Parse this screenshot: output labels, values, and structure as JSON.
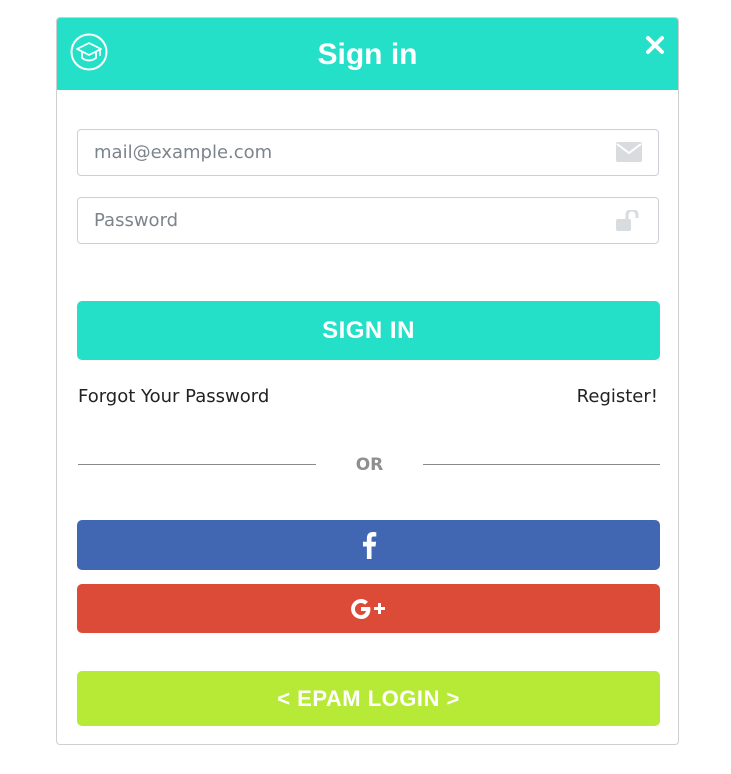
{
  "header": {
    "title": "Sign in",
    "logo_icon": "graduation-cap-icon",
    "close_icon": "close-icon",
    "accent_color": "#25e0c8"
  },
  "form": {
    "email": {
      "value": "",
      "placeholder": "mail@example.com",
      "icon": "envelope-icon"
    },
    "password": {
      "value": "",
      "placeholder": "Password",
      "icon": "unlock-icon"
    },
    "submit_label": "SIGN IN"
  },
  "links": {
    "forgot": "Forgot Your Password",
    "register": "Register!"
  },
  "divider": {
    "label": "OR"
  },
  "social": {
    "facebook": {
      "icon": "facebook-icon",
      "color": "#4167b2"
    },
    "google": {
      "icon": "google-plus-icon",
      "color": "#dc4a38"
    }
  },
  "epam": {
    "label": "< EPAM LOGIN >",
    "color": "#b6ea36"
  }
}
